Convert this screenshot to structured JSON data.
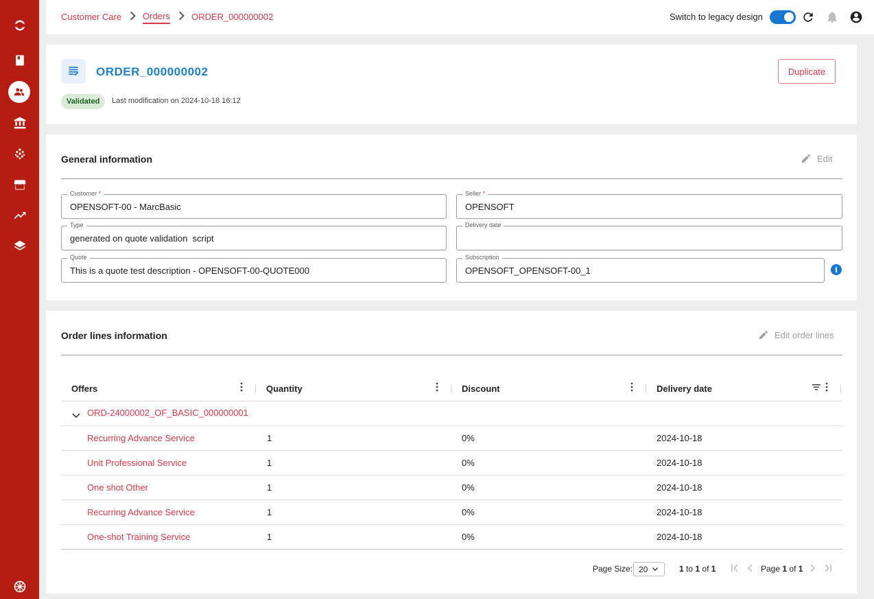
{
  "sidebar": {
    "items": [
      {
        "icon": "logo-icon"
      },
      {
        "icon": "book-icon"
      },
      {
        "icon": "customers-icon",
        "active": true
      },
      {
        "icon": "bank-icon"
      },
      {
        "icon": "dots-grid-icon"
      },
      {
        "icon": "store-icon"
      },
      {
        "icon": "trending-up-icon"
      },
      {
        "icon": "layers-icon"
      },
      {
        "icon": "language-flag-icon"
      }
    ]
  },
  "breadcrumb": {
    "items": [
      "Customer Care",
      "Orders",
      "ORDER_000000002"
    ]
  },
  "topbar": {
    "legacy_label": "Switch to legacy design",
    "legacy_on": true
  },
  "order": {
    "title": "ORDER_000000002",
    "status": "Validated",
    "last_modification": "Last modification on 2024-10-18 16:12",
    "duplicate_label": "Duplicate"
  },
  "general": {
    "title": "General information",
    "edit_label": "Edit",
    "fields": {
      "customer": {
        "label": "Customer",
        "value": "OPENSOFT-00 - MarcBasic",
        "required": true
      },
      "seller": {
        "label": "Seller",
        "value": "OPENSOFT",
        "required": true
      },
      "type": {
        "label": "Type",
        "value": "generated on quote validation  script"
      },
      "delivery_date": {
        "label": "Delivery date",
        "value": ""
      },
      "quote": {
        "label": "Quote",
        "value": "This is a quote test description - OPENSOFT-00-QUOTE000"
      },
      "subscription": {
        "label": "Subscription",
        "value": "OPENSOFT_OPENSOFT-00_1"
      }
    },
    "required_mark": "*"
  },
  "order_lines": {
    "title": "Order lines information",
    "edit_label": "Edit order lines",
    "columns": [
      "Offers",
      "Quantity",
      "Discount",
      "Delivery date"
    ],
    "group": "ORD-24000002_OF_BASIC_000000001",
    "rows": [
      {
        "offer": "Recurring Advance Service",
        "quantity": "1",
        "discount": "0%",
        "delivery": "2024-10-18"
      },
      {
        "offer": "Unit Professional Service",
        "quantity": "1",
        "discount": "0%",
        "delivery": "2024-10-18"
      },
      {
        "offer": "One shot Other",
        "quantity": "1",
        "discount": "0%",
        "delivery": "2024-10-18"
      },
      {
        "offer": "Recurring Advance Service",
        "quantity": "1",
        "discount": "0%",
        "delivery": "2024-10-18"
      },
      {
        "offer": "One-shot Training Service",
        "quantity": "1",
        "discount": "0%",
        "delivery": "2024-10-18"
      }
    ],
    "pager": {
      "page_size_label": "Page Size:",
      "page_size": "20",
      "range_from": "1",
      "range_to_label": "to",
      "range_to": "1",
      "range_of_label": "of",
      "range_total": "1",
      "page_label": "Page",
      "page": "1",
      "page_of_label": "of",
      "page_total": "1"
    }
  },
  "colors": {
    "sidebar": "#b51d13",
    "accent": "#d93a4a",
    "title_blue": "#1f7fc9",
    "toggle_blue": "#1976d2"
  }
}
